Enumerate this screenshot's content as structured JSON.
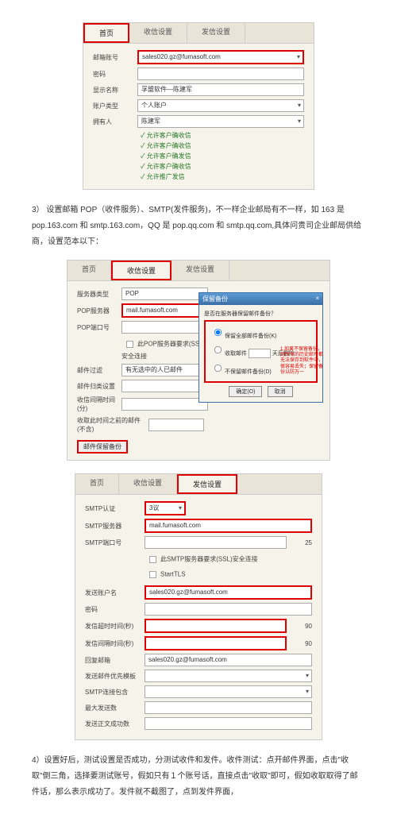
{
  "panel1": {
    "tabs": [
      "首页",
      "收信设置",
      "发信设置"
    ],
    "activeTab": 0,
    "rows": {
      "mailAccountLabel": "邮箱账号",
      "mailAccountValue": "sales020.gz@fumasoft.com",
      "passwordLabel": "密码",
      "displayNameLabel": "显示名称",
      "displayNameValue": "孚盟软件—陈建军",
      "accountTypeLabel": "账户类型",
      "accountTypeValue": "个人账户",
      "ownerLabel": "拥有人",
      "ownerValue": "陈建军"
    },
    "checks": [
      "允许客户确收信",
      "允许客户确收信",
      "允许客户确发信",
      "允许客户确收信",
      "允许推广发信"
    ]
  },
  "para3": "3） 设置邮箱 POP（收件服务）、SMTP(发件服务)，不一样企业邮局有不一样，如 163 是 pop.163.com 和 smtp.163.com，QQ 是 pop.qq.com 和 smtp.qq.com,具体问贵司企业邮局供给商，设置范本以下：",
  "panel2": {
    "tabs": [
      "首页",
      "收信设置",
      "发信设置"
    ],
    "activeTab": 1,
    "rows": {
      "serverTypeLabel": "服务器类型",
      "serverTypeValue": "POP",
      "popServerLabel": "POP服务器",
      "popServerValue": "mail.fumasoft.com",
      "popPortLabel": "POP端口号",
      "popPortValue": "",
      "sslLabel": "此POP服务器要求(SSL)安全连接",
      "filterLabel": "邮件过滤",
      "filterValue": "有无选中的人已邮件",
      "categoryLabel": "邮件归类设置",
      "categoryValue": "",
      "intervalLabel": "收信间隔时间(分)",
      "intervalValue": "",
      "beforeLabel": "收取此时间之前的邮件(不含)",
      "beforeValue": ""
    },
    "backupBtn": "邮件保留备份",
    "dialog": {
      "title": "保留备份",
      "groupTitle": "是否在服务器保留邮件备份？",
      "opt1": "保留全部邮件备份(K)",
      "opt2": "收取邮件",
      "opt2b": "天后删除",
      "opt3": "不保留邮件备份(D)",
      "note": "1.如果不保留备份，则所有的历史邮件都无法保存到软件中，很容易丢失；保留备份以防万一",
      "ok": "确定(O)",
      "cancel": "取消"
    }
  },
  "panel3": {
    "tabs": [
      "首页",
      "收信设置",
      "发信设置"
    ],
    "activeTab": 2,
    "rows": {
      "smtpAuthLabel": "SMTP认证",
      "smtpAuthValue": "3议",
      "smtpServerLabel": "SMTP服务器",
      "smtpServerValue": "mail.fumasoft.com",
      "smtpPortLabel": "SMTP端口号",
      "smtpPortValue": "",
      "smtpPortSuffix": "25",
      "sslLabel": "此SMTP服务器要求(SSL)安全连接",
      "tlsLabel": "StartTLS",
      "sendAccountLabel": "发送账户名",
      "sendAccountValue": "sales020.gz@fumasoft.com",
      "sendPwdLabel": "密码",
      "timeoutLabel": "发信超时时间(秒)",
      "timeoutSuffix": "90",
      "gapLabel": "发信间隔时间(秒)",
      "gapSuffix": "90",
      "replyLabel": "回复邮箱",
      "replyValue": "sales020.gz@fumasoft.com",
      "tplLabel": "发送邮件优先模板",
      "smtpIncludeLabel": "SMTP连接包含",
      "maxRcptLabel": "最大发送数",
      "allowSucLabel": "发送正文成功数"
    }
  },
  "para4": "4）设置好后，测试设置是否成功，分测试收件和发件。收件测试：点开邮件界面，点击\"收取\"倒三角，选择要测试账号，假如只有１个账号话，直接点击\"收取\"即可，假如收取取得了邮件话，那么表示成功了。发件就不截图了，点到发件界面，"
}
